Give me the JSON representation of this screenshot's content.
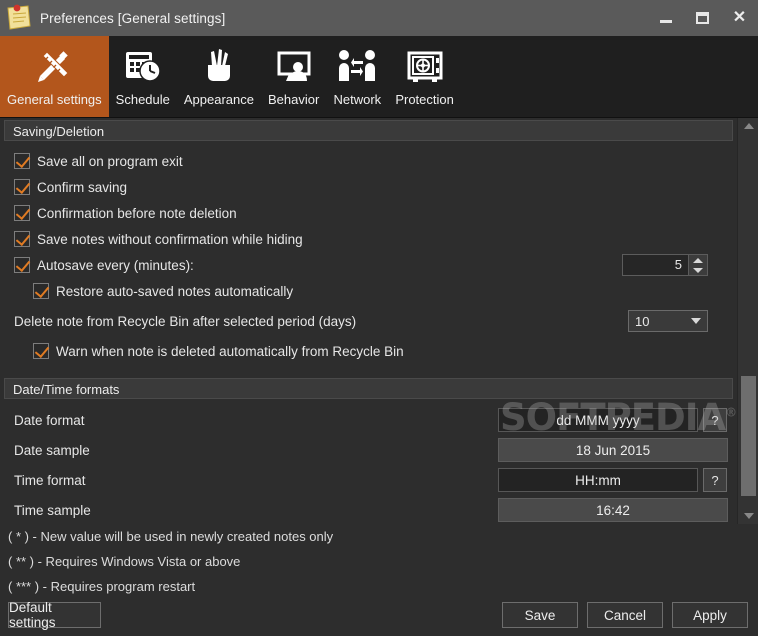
{
  "window": {
    "title": "Preferences [General settings]",
    "icon": "sticky-note-icon",
    "controls": {
      "minimize": "–",
      "maximize": "□",
      "close": "✕"
    }
  },
  "toolbar": {
    "active_index": 0,
    "accent_color": "#b3561c",
    "tabs": [
      {
        "label": "General settings",
        "icon": "pencil-ruler-icon"
      },
      {
        "label": "Schedule",
        "icon": "calendar-clock-icon"
      },
      {
        "label": "Appearance",
        "icon": "pencil-cup-icon"
      },
      {
        "label": "Behavior",
        "icon": "monitor-person-icon"
      },
      {
        "label": "Network",
        "icon": "two-people-arrows-icon"
      },
      {
        "label": "Protection",
        "icon": "safe-vault-icon"
      }
    ]
  },
  "sections": {
    "saving": {
      "header": "Saving/Deletion",
      "checkboxes": [
        {
          "label": "Save all on program exit",
          "checked": true
        },
        {
          "label": "Confirm saving",
          "checked": true
        },
        {
          "label": "Confirmation before note deletion",
          "checked": true
        },
        {
          "label": "Save notes without confirmation while hiding",
          "checked": true
        },
        {
          "label": "Autosave every (minutes):",
          "checked": true
        },
        {
          "label": "Restore auto-saved notes automatically",
          "checked": true
        }
      ],
      "autosave_minutes": "5",
      "recycle_label": "Delete note from Recycle Bin after selected period (days)",
      "recycle_days": "10",
      "warn_label": "Warn when note is deleted automatically from Recycle Bin",
      "warn_checked": true
    },
    "datetime": {
      "header": "Date/Time formats",
      "help_label": "?",
      "rows": [
        {
          "label": "Date format",
          "value": "dd MMM yyyy",
          "editable": true,
          "help": true
        },
        {
          "label": "Date sample",
          "value": "18 Jun 2015",
          "editable": false,
          "help": false
        },
        {
          "label": "Time format",
          "value": "HH:mm",
          "editable": true,
          "help": true
        },
        {
          "label": "Time sample",
          "value": "16:42",
          "editable": false,
          "help": false
        }
      ]
    }
  },
  "footer": {
    "notes": [
      "( * ) - New value will be used in newly created notes only",
      "( ** ) - Requires Windows Vista or above",
      "( *** ) - Requires program restart"
    ],
    "default_button": "Default settings",
    "save_button": "Save",
    "cancel_button": "Cancel",
    "apply_button": "Apply"
  },
  "watermark": {
    "text": "SOFTPEDIA",
    "mark": "®"
  }
}
